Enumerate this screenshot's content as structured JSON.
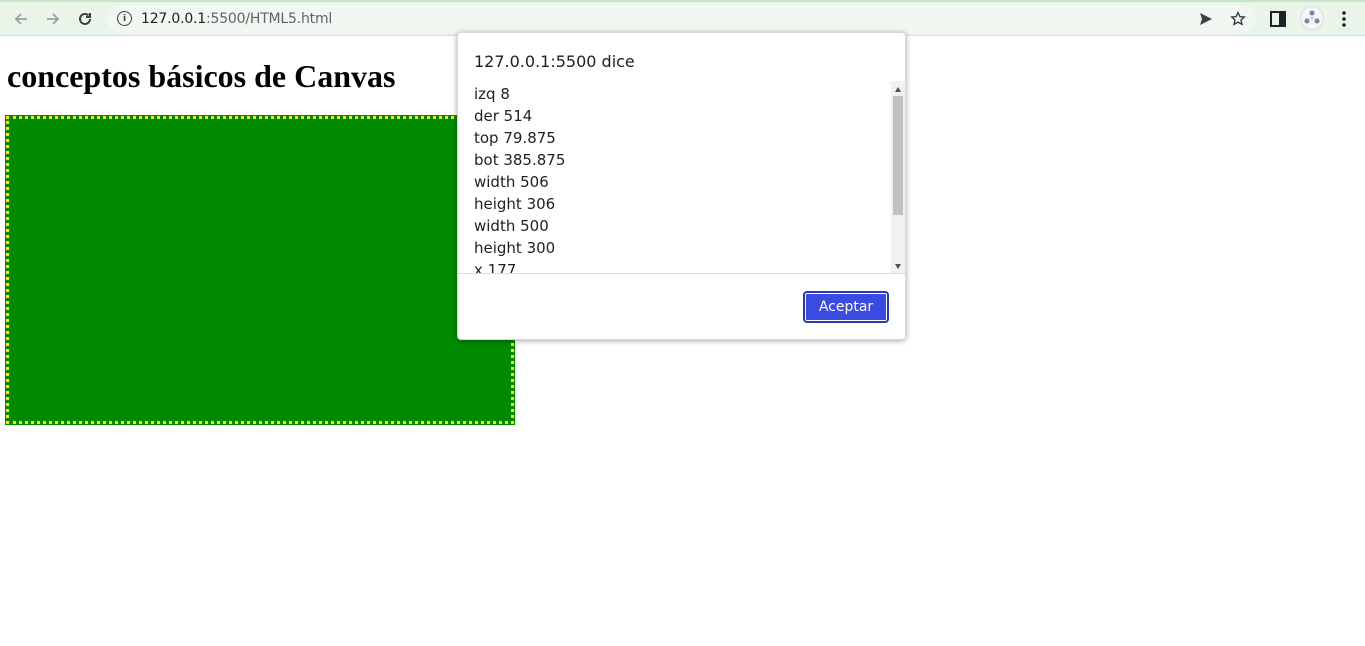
{
  "browser": {
    "url_host": "127.0.0.1",
    "url_rest": ":5500/HTML5.html"
  },
  "page": {
    "heading": "conceptos básicos de Canvas",
    "colors": {
      "canvas_fill": "#008a00",
      "canvas_border": "#ffe600"
    }
  },
  "dialog": {
    "title": "127.0.0.1:5500 dice",
    "lines": [
      "izq 8",
      "der 514",
      "top 79.875",
      "bot 385.875",
      "width 506",
      "height 306",
      "width 500",
      "height 300",
      "x 177"
    ],
    "accept_label": "Aceptar",
    "accent_color": "#3b4be0"
  }
}
